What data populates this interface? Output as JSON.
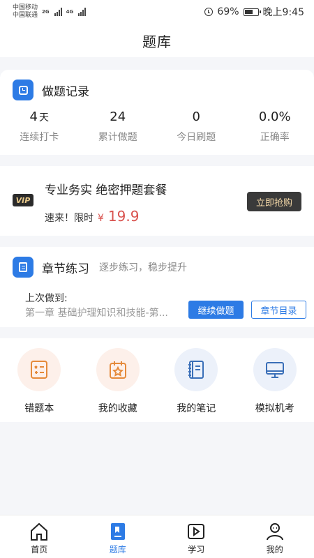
{
  "status_bar": {
    "carrier_1": "中国移动",
    "carrier_2": "中国联通",
    "net_1": "2G",
    "net_2": "4G",
    "battery": "69%",
    "time": "晚上9:45",
    "battery_level_percent": 69
  },
  "header": {
    "title": "题库"
  },
  "record": {
    "title": "做题记录",
    "stats": [
      {
        "value": "4",
        "unit": "天",
        "label": "连续打卡"
      },
      {
        "value": "24",
        "unit": "",
        "label": "累计做题"
      },
      {
        "value": "0",
        "unit": "",
        "label": "今日刷题"
      },
      {
        "value": "0.0%",
        "unit": "",
        "label": "正确率"
      }
    ]
  },
  "vip": {
    "badge": "VIP",
    "title": "专业务实 绝密押题套餐",
    "promo": "速来！限时",
    "currency": "¥",
    "price": "19.9",
    "button": "立即抢购"
  },
  "chapter": {
    "title": "章节练习",
    "subtitle": "逐步练习，稳步提升",
    "last_label": "上次做到:",
    "last_chapter": "第一章 基础护理知识和技能-第...",
    "continue_button": "继续做题",
    "catalog_button": "章节目录"
  },
  "features": [
    {
      "label": "错题本",
      "icon": "wrong-questions-icon"
    },
    {
      "label": "我的收藏",
      "icon": "favorites-icon"
    },
    {
      "label": "我的笔记",
      "icon": "notes-icon"
    },
    {
      "label": "模拟机考",
      "icon": "mock-exam-icon"
    }
  ],
  "tabbar": [
    {
      "label": "首页",
      "icon": "home-icon"
    },
    {
      "label": "题库",
      "icon": "question-bank-icon",
      "active": true
    },
    {
      "label": "学习",
      "icon": "study-icon"
    },
    {
      "label": "我的",
      "icon": "profile-icon"
    }
  ],
  "colors": {
    "accent": "#2d7be5",
    "price": "#d9534f",
    "warm_icon": "#e58a3a",
    "cool_icon": "#3a6fb8"
  }
}
